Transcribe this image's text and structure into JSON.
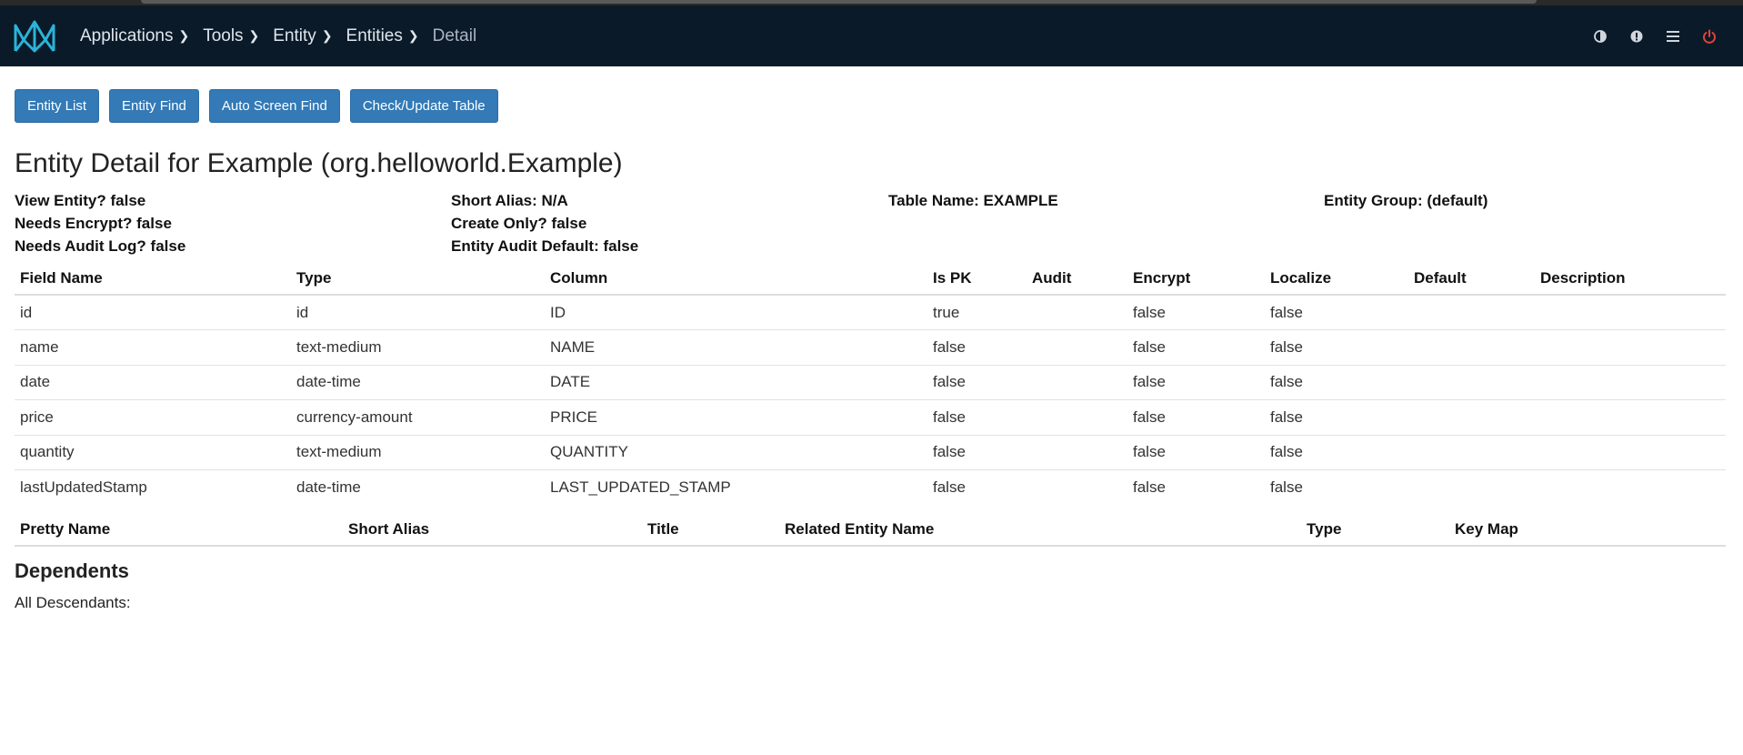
{
  "breadcrumbs": [
    {
      "label": "Applications"
    },
    {
      "label": "Tools"
    },
    {
      "label": "Entity"
    },
    {
      "label": "Entities"
    },
    {
      "label": "Detail"
    }
  ],
  "nav_icons": [
    "contrast-icon",
    "alert-icon",
    "menu-icon",
    "power-icon"
  ],
  "buttons": {
    "entity_list": "Entity List",
    "entity_find": "Entity Find",
    "auto_screen_find": "Auto Screen Find",
    "check_update_table": "Check/Update Table"
  },
  "page_title": "Entity Detail for Example (org.helloworld.Example)",
  "properties": {
    "view_entity": "View Entity? false",
    "short_alias": "Short Alias: N/A",
    "table_name": "Table Name: EXAMPLE",
    "entity_group": "Entity Group: (default)",
    "needs_encrypt": "Needs Encrypt? false",
    "create_only": "Create Only? false",
    "needs_audit_log": "Needs Audit Log? false",
    "entity_audit_default": "Entity Audit Default: false"
  },
  "fields_table": {
    "headers": [
      "Field Name",
      "Type",
      "Column",
      "Is PK",
      "Audit",
      "Encrypt",
      "Localize",
      "Default",
      "Description"
    ],
    "rows": [
      [
        "id",
        "id",
        "ID",
        "true",
        "",
        "false",
        "false",
        "",
        ""
      ],
      [
        "name",
        "text-medium",
        "NAME",
        "false",
        "",
        "false",
        "false",
        "",
        ""
      ],
      [
        "date",
        "date-time",
        "DATE",
        "false",
        "",
        "false",
        "false",
        "",
        ""
      ],
      [
        "price",
        "currency-amount",
        "PRICE",
        "false",
        "",
        "false",
        "false",
        "",
        ""
      ],
      [
        "quantity",
        "text-medium",
        "QUANTITY",
        "false",
        "",
        "false",
        "false",
        "",
        ""
      ],
      [
        "lastUpdatedStamp",
        "date-time",
        "LAST_UPDATED_STAMP",
        "false",
        "",
        "false",
        "false",
        "",
        ""
      ]
    ]
  },
  "relationships_table": {
    "headers": [
      "Pretty Name",
      "Short Alias",
      "Title",
      "Related Entity Name",
      "Type",
      "Key Map"
    ]
  },
  "dependents": {
    "title": "Dependents",
    "all_descendants": "All Descendants:"
  }
}
